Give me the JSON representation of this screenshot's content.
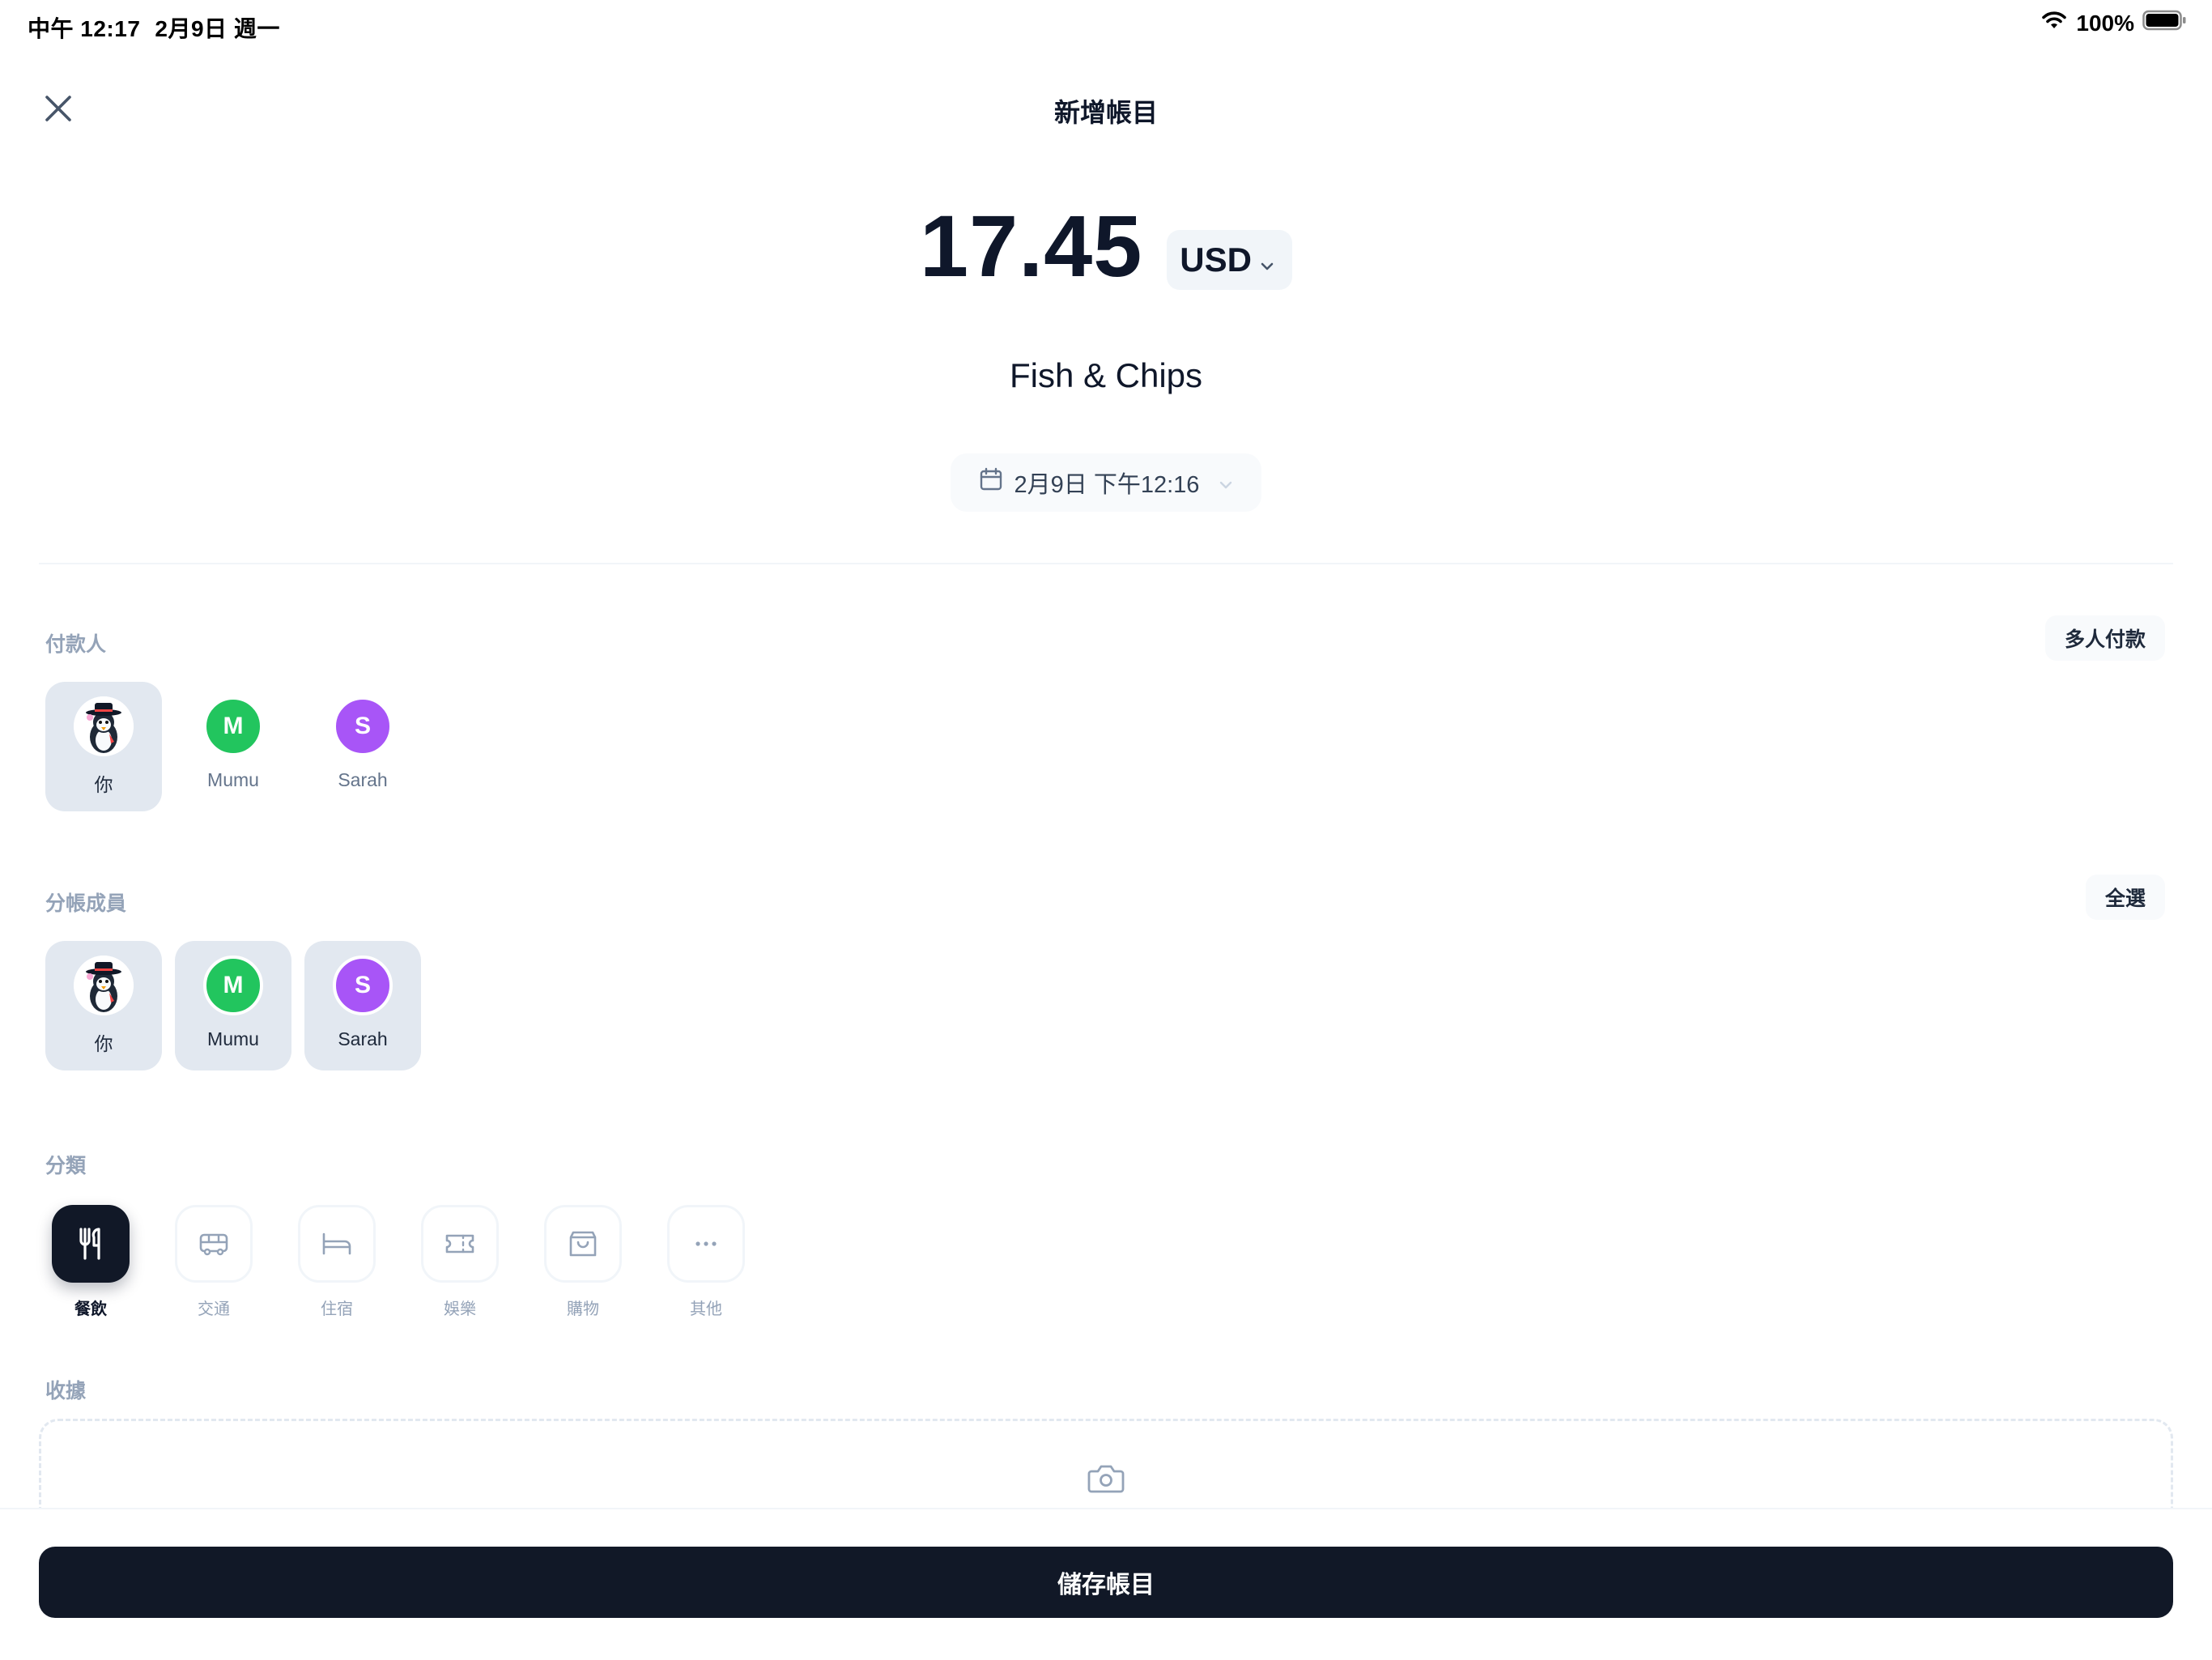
{
  "status_bar": {
    "time": "中午 12:17",
    "date": "2月9日 週一",
    "battery": "100%"
  },
  "header": {
    "title": "新增帳目"
  },
  "expense": {
    "amount": "17.45",
    "currency": "USD",
    "description": "Fish & Chips",
    "datetime": "2月9日 下午12:16"
  },
  "payer_section": {
    "label": "付款人",
    "action": "多人付款",
    "members": [
      {
        "name": "你",
        "initial": "",
        "selected": true
      },
      {
        "name": "Mumu",
        "initial": "M",
        "selected": false
      },
      {
        "name": "Sarah",
        "initial": "S",
        "selected": false
      }
    ]
  },
  "split_section": {
    "label": "分帳成員",
    "action": "全選",
    "members": [
      {
        "name": "你",
        "initial": "",
        "selected": true
      },
      {
        "name": "Mumu",
        "initial": "M",
        "selected": true
      },
      {
        "name": "Sarah",
        "initial": "S",
        "selected": true
      }
    ]
  },
  "category_section": {
    "label": "分類",
    "items": [
      {
        "label": "餐飲",
        "icon": "utensils-icon",
        "active": true
      },
      {
        "label": "交通",
        "icon": "bus-icon",
        "active": false
      },
      {
        "label": "住宿",
        "icon": "bed-icon",
        "active": false
      },
      {
        "label": "娛樂",
        "icon": "ticket-icon",
        "active": false
      },
      {
        "label": "購物",
        "icon": "shopping-bag-icon",
        "active": false
      },
      {
        "label": "其他",
        "icon": "more-icon",
        "active": false
      }
    ]
  },
  "receipt_section": {
    "label": "收據",
    "icon": "camera-icon"
  },
  "footer": {
    "save_label": "儲存帳目"
  },
  "colors": {
    "primary": "#111827",
    "mumu": "#22c55e",
    "sarah": "#a855f7",
    "selected_bg": "#e2e8f0"
  }
}
